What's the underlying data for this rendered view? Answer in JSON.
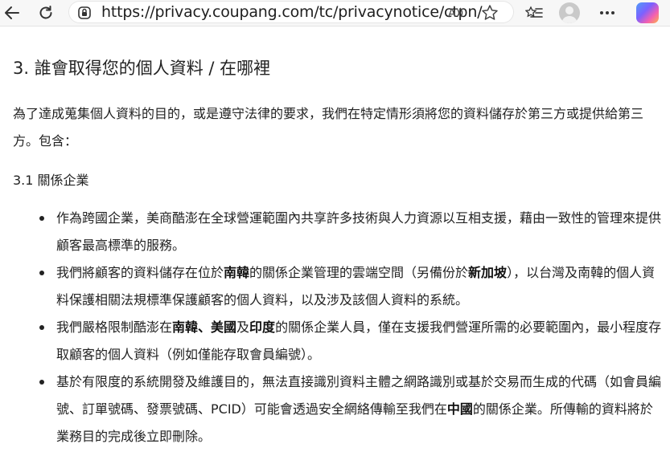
{
  "browser": {
    "url": "https://privacy.coupang.com/tc/privacynotice/ctpn/",
    "icons": [
      "back-arrow-icon",
      "refresh-icon",
      "lock-icon",
      "read-aloud-icon",
      "favorite-star-icon",
      "favorites-list-icon",
      "profile-avatar",
      "more-icon",
      "copilot-icon"
    ]
  },
  "section": {
    "title": "3. 誰會取得您的個人資料 / 在哪裡",
    "intro": "為了達成蒐集個人資料的目的，或是遵守法律的要求，我們在特定情形須將您的資料儲存於第三方或提供給第三方。包含：",
    "subsection_title": "3.1 關係企業",
    "items": [
      {
        "parts": [
          {
            "t": "作為跨國企業，美商酷澎在全球營運範圍內共享許多技術與人力資源以互相支援，藉由一致性的管理來提供顧客最高標準的服務。",
            "b": false
          }
        ]
      },
      {
        "parts": [
          {
            "t": "我們將顧客的資料儲存在位於",
            "b": false
          },
          {
            "t": "南韓",
            "b": true
          },
          {
            "t": "的關係企業管理的雲端空間（另備份於",
            "b": false
          },
          {
            "t": "新加坡",
            "b": true
          },
          {
            "t": "），以台灣及南韓的個人資料保護相關法規標準保護顧客的個人資料，以及涉及該個人資料的系統。",
            "b": false
          }
        ]
      },
      {
        "parts": [
          {
            "t": "我們嚴格限制酷澎在",
            "b": false
          },
          {
            "t": "南韓、美國",
            "b": true
          },
          {
            "t": "及",
            "b": false
          },
          {
            "t": "印度",
            "b": true
          },
          {
            "t": "的關係企業人員，僅在支援我們營運所需的必要範圍內，最小程度存取顧客的個人資料（例如僅能存取會員編號）。",
            "b": false
          }
        ]
      },
      {
        "parts": [
          {
            "t": "基於有限度的系統開發及維護目的，無法直接識別資料主體之網路識別或基於交易而生成的代碼（如會員編號、訂單號碼、發票號碼、PCID）可能會透過安全網絡傳輸至我們在",
            "b": false
          },
          {
            "t": "中國",
            "b": true
          },
          {
            "t": "的關係企業。所傳輸的資料將於業務目的完成後立即刪除。",
            "b": false
          }
        ]
      }
    ]
  }
}
